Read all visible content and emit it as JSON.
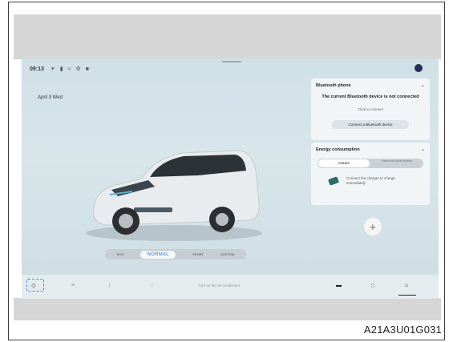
{
  "statusbar": {
    "time": "09:13",
    "icons": [
      "bluetooth-icon",
      "signal-icon",
      "wifi-icon",
      "settings-icon",
      "message-icon"
    ]
  },
  "home": {
    "date": "April 3 Wed"
  },
  "bluetooth_panel": {
    "title": "Bluetooth phone",
    "message": "The current Bluetooth device is not connected",
    "hint": "Click to connect",
    "button": "Connect a Bluetooth device"
  },
  "energy_panel": {
    "title": "Energy consumption",
    "tabs": [
      "Instant",
      "Historical consumption"
    ],
    "message": "Connect the charger to charge immediately"
  },
  "drive_modes": {
    "items": [
      "ECO",
      "NORMAL",
      "SPORT",
      "CUSTOM"
    ],
    "selected": "NORMAL"
  },
  "dock": {
    "ac_text": "Turn on the air conditioner",
    "items": [
      "fan-icon",
      "seat-heat-icon",
      "defrost-icon",
      "steering-wheel-icon",
      "car-icon",
      "apps-icon",
      "home-icon"
    ]
  },
  "figure_code": "A21A3U01G031",
  "colors": {
    "accent": "#2a7dd2",
    "screen_bg": "#d4e3e8"
  }
}
